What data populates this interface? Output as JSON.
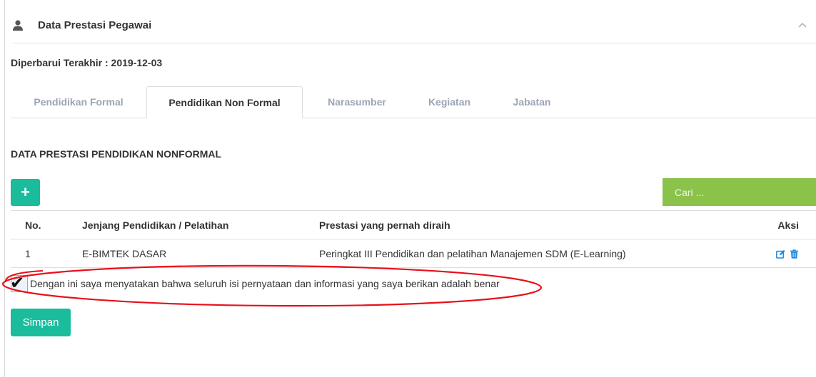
{
  "panel": {
    "title": "Data Prestasi Pegawai",
    "icon": "user-icon",
    "collapse_icon": "chevron-up-icon"
  },
  "updated_text": "Diperbarui Terakhir : 2019-12-03",
  "tabs": [
    {
      "label": "Pendidikan Formal",
      "active": false
    },
    {
      "label": "Pendidikan Non Formal",
      "active": true
    },
    {
      "label": "Narasumber",
      "active": false
    },
    {
      "label": "Kegiatan",
      "active": false
    },
    {
      "label": "Jabatan",
      "active": false
    }
  ],
  "section_title": "DATA PRESTASI PENDIDIKAN NONFORMAL",
  "add_button": {
    "label": "+",
    "icon": "plus-icon"
  },
  "search": {
    "placeholder": "Cari ..."
  },
  "table": {
    "headers": [
      "No.",
      "Jenjang Pendidikan / Pelatihan",
      "Prestasi yang pernah diraih",
      "Aksi"
    ],
    "rows": [
      {
        "no": "1",
        "jenjang": "E-BIMTEK DASAR",
        "prestasi": "Peringkat III Pendidikan dan pelatihan Manajemen SDM (E-Learning)",
        "actions": [
          "edit-icon",
          "trash-icon"
        ]
      }
    ]
  },
  "declaration": {
    "checked": true,
    "label": "Dengan ini saya menyatakan bahwa seluruh isi pernyataan dan informasi yang saya berikan adalah benar"
  },
  "save_button": {
    "label": "Simpan"
  },
  "colors": {
    "primary_green": "#1abc9c",
    "search_green": "#8bc34a",
    "inactive_tab": "#9aa5b6",
    "annotation_red": "#e8101a",
    "action_blue": "#1e88e5"
  }
}
